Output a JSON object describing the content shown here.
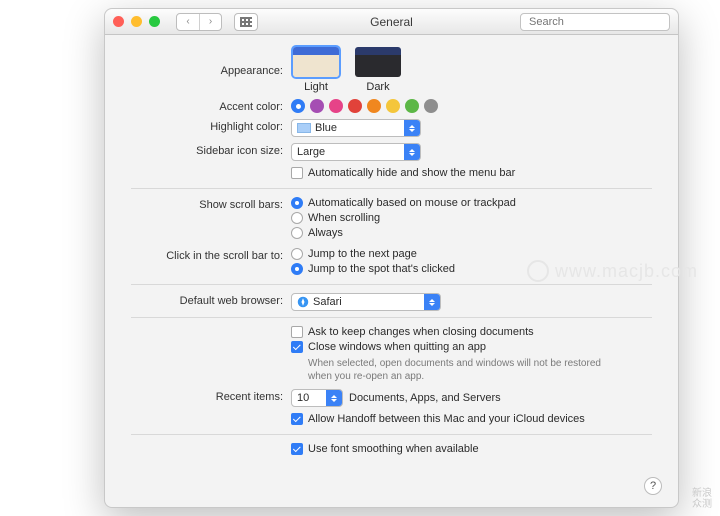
{
  "window": {
    "title": "General",
    "search_placeholder": "Search"
  },
  "appearance": {
    "label": "Appearance:",
    "options": [
      "Light",
      "Dark"
    ],
    "selected": "Light"
  },
  "accent": {
    "label": "Accent color:",
    "colors": [
      "#2f7cf6",
      "#a54eb3",
      "#e64388",
      "#e1423a",
      "#f0871f",
      "#f4c63b",
      "#5cb746",
      "#8e8e8e"
    ],
    "selected_index": 0
  },
  "highlight": {
    "label": "Highlight color:",
    "value": "Blue"
  },
  "sidebar_size": {
    "label": "Sidebar icon size:",
    "value": "Large"
  },
  "auto_hide_menubar": {
    "label": "Automatically hide and show the menu bar",
    "checked": false
  },
  "scrollbars": {
    "label": "Show scroll bars:",
    "options": [
      "Automatically based on mouse or trackpad",
      "When scrolling",
      "Always"
    ],
    "selected_index": 0
  },
  "clickbar": {
    "label": "Click in the scroll bar to:",
    "options": [
      "Jump to the next page",
      "Jump to the spot that's clicked"
    ],
    "selected_index": 1
  },
  "browser": {
    "label": "Default web browser:",
    "value": "Safari"
  },
  "ask_changes": {
    "label": "Ask to keep changes when closing documents",
    "checked": false
  },
  "close_windows": {
    "label": "Close windows when quitting an app",
    "checked": true,
    "hint": "When selected, open documents and windows will not be restored when you re-open an app."
  },
  "recent": {
    "label": "Recent items:",
    "value": "10",
    "suffix": "Documents, Apps, and Servers"
  },
  "handoff": {
    "label": "Allow Handoff between this Mac and your iCloud devices",
    "checked": true
  },
  "font_smoothing": {
    "label": "Use font smoothing when available",
    "checked": true
  },
  "watermark": "www.macjb.com",
  "brand": {
    "l1": "新浪",
    "l2": "众测"
  }
}
